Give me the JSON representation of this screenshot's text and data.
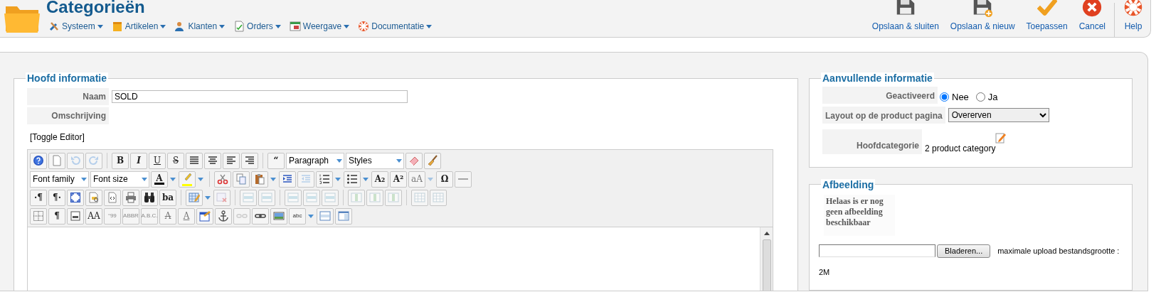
{
  "header": {
    "title": "Categorieën",
    "menu": [
      {
        "label": "Systeem"
      },
      {
        "label": "Artikelen"
      },
      {
        "label": "Klanten"
      },
      {
        "label": "Orders"
      },
      {
        "label": "Weergave"
      },
      {
        "label": "Documentatie"
      }
    ],
    "toolbar": [
      {
        "label": "Opslaan & sluiten"
      },
      {
        "label": "Opslaan & nieuw"
      },
      {
        "label": "Toepassen"
      },
      {
        "label": "Cancel"
      },
      {
        "label": "Help"
      }
    ]
  },
  "main_info": {
    "legend": "Hoofd informatie",
    "fields": [
      {
        "label": "Naam",
        "value": "SOLD"
      },
      {
        "label": "Omschrijving"
      }
    ],
    "toggle_editor": "[Toggle Editor]",
    "editor_toolbar": [
      [
        {
          "kind": "button",
          "disabled": false
        },
        {
          "kind": "button",
          "disabled": false
        },
        {
          "kind": "button",
          "disabled": true
        },
        {
          "kind": "button",
          "disabled": true
        },
        {
          "kind": "sep"
        },
        {
          "kind": "glyph",
          "text": "B",
          "disabled": false
        },
        {
          "kind": "glyph",
          "text": "I",
          "disabled": false
        },
        {
          "kind": "glyph",
          "text": "U",
          "disabled": false
        },
        {
          "kind": "glyph",
          "text": "S",
          "disabled": false
        },
        {
          "kind": "button",
          "disabled": false
        },
        {
          "kind": "button",
          "disabled": false
        },
        {
          "kind": "button",
          "disabled": false
        },
        {
          "kind": "button",
          "disabled": false
        },
        {
          "kind": "sep"
        },
        {
          "kind": "glyph",
          "text": "“",
          "disabled": false
        },
        {
          "kind": "select",
          "value": "Paragraph"
        },
        {
          "kind": "select",
          "value": "Styles"
        },
        {
          "kind": "button",
          "disabled": false
        },
        {
          "kind": "button",
          "disabled": false
        }
      ],
      [
        {
          "kind": "select",
          "value": "Font family"
        },
        {
          "kind": "select",
          "value": "Font size"
        },
        {
          "kind": "glyph_split",
          "text": "A",
          "disabled": false,
          "color": "#000000"
        },
        {
          "kind": "split",
          "disabled": false,
          "color": "#ffff00"
        },
        {
          "kind": "sep"
        },
        {
          "kind": "button",
          "disabled": false
        },
        {
          "kind": "button",
          "disabled": false
        },
        {
          "kind": "split",
          "disabled": false
        },
        {
          "kind": "button",
          "disabled": false
        },
        {
          "kind": "button",
          "disabled": true
        },
        {
          "kind": "split",
          "disabled": false
        },
        {
          "kind": "split",
          "disabled": false
        },
        {
          "kind": "glyph",
          "text": "A₂",
          "disabled": false
        },
        {
          "kind": "glyph",
          "text": "A²",
          "disabled": false
        },
        {
          "kind": "glyph_split",
          "text": "aA",
          "disabled": true
        },
        {
          "kind": "glyph",
          "text": "Ω",
          "disabled": false
        },
        {
          "kind": "button",
          "disabled": false
        }
      ],
      [
        {
          "kind": "glyph",
          "text": "·¶",
          "disabled": false
        },
        {
          "kind": "glyph",
          "text": "¶·",
          "disabled": false
        },
        {
          "kind": "button",
          "disabled": false
        },
        {
          "kind": "button",
          "disabled": false
        },
        {
          "kind": "button",
          "disabled": false
        },
        {
          "kind": "button",
          "disabled": false
        },
        {
          "kind": "button",
          "disabled": false
        },
        {
          "kind": "glyph",
          "text": "ba",
          "disabled": false
        },
        {
          "kind": "sep"
        },
        {
          "kind": "split",
          "disabled": false
        },
        {
          "kind": "button",
          "disabled": true
        },
        {
          "kind": "sep"
        },
        {
          "kind": "button",
          "disabled": true
        },
        {
          "kind": "button",
          "disabled": true
        },
        {
          "kind": "sep"
        },
        {
          "kind": "button",
          "disabled": true
        },
        {
          "kind": "button",
          "disabled": true
        },
        {
          "kind": "button",
          "disabled": true
        },
        {
          "kind": "sep"
        },
        {
          "kind": "button",
          "disabled": true
        },
        {
          "kind": "button",
          "disabled": true
        },
        {
          "kind": "button",
          "disabled": true
        },
        {
          "kind": "sep"
        },
        {
          "kind": "button",
          "disabled": true
        },
        {
          "kind": "button",
          "disabled": true
        }
      ],
      [
        {
          "kind": "button",
          "disabled": false
        },
        {
          "kind": "glyph",
          "text": "¶",
          "disabled": false
        },
        {
          "kind": "button",
          "disabled": false
        },
        {
          "kind": "glyph",
          "text": "AA",
          "disabled": false
        },
        {
          "kind": "glyph",
          "text": "“99",
          "disabled": true
        },
        {
          "kind": "glyph",
          "text": "ABBR",
          "disabled": true
        },
        {
          "kind": "glyph",
          "text": "A.B.C.",
          "disabled": true
        },
        {
          "kind": "glyph",
          "text": "A",
          "disabled": true
        },
        {
          "kind": "glyph",
          "text": "A",
          "disabled": true
        },
        {
          "kind": "button",
          "disabled": false
        },
        {
          "kind": "button",
          "disabled": false
        },
        {
          "kind": "button",
          "disabled": true
        },
        {
          "kind": "button",
          "disabled": false
        },
        {
          "kind": "button",
          "disabled": false
        },
        {
          "kind": "glyph_split",
          "text": "abc",
          "disabled": false
        },
        {
          "kind": "button",
          "disabled": false
        },
        {
          "kind": "button",
          "disabled": false
        }
      ]
    ]
  },
  "extra_info": {
    "legend": "Aanvullende informatie",
    "activated": {
      "label": "Geactiveerd",
      "options": [
        {
          "label": "Nee",
          "selected": true
        },
        {
          "label": "Ja",
          "selected": false
        }
      ]
    },
    "layout": {
      "label": "Layout op de product pagina",
      "value": "Overerven"
    },
    "parent": {
      "label": "Hoofdcategorie",
      "value": "2 product category"
    }
  },
  "image": {
    "legend": "Afbeelding",
    "no_image_text": "Helaas is er nog geen afbeelding beschikbaar",
    "browse_button": "Bladeren...",
    "upload_note": "maximale upload bestandsgrootte :",
    "max_size": "2M"
  }
}
